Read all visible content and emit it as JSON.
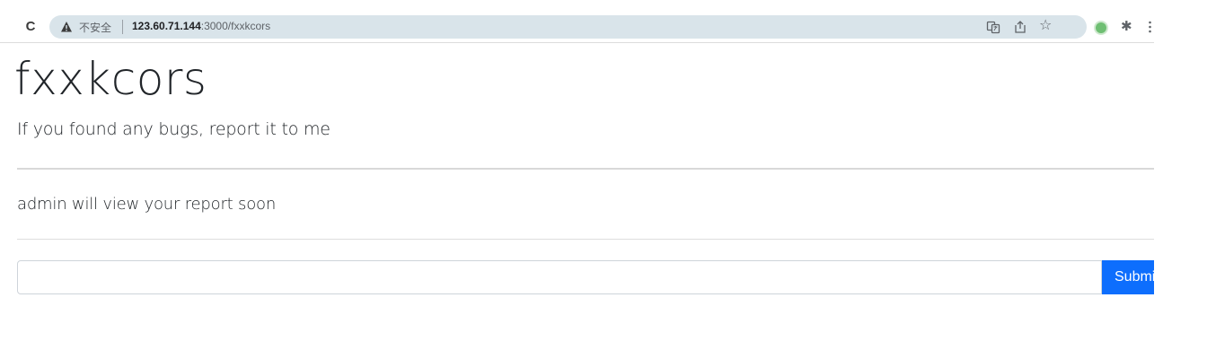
{
  "browser": {
    "security_label": "不安全",
    "url_host": "123.60.71.144",
    "url_rest": ":3000/fxxkcors"
  },
  "page": {
    "title": "fxxkcors",
    "lead": "If you found any bugs, report it to me",
    "notice": "admin will view your report soon"
  },
  "form": {
    "input_value": "",
    "submit_label": "Submit"
  }
}
